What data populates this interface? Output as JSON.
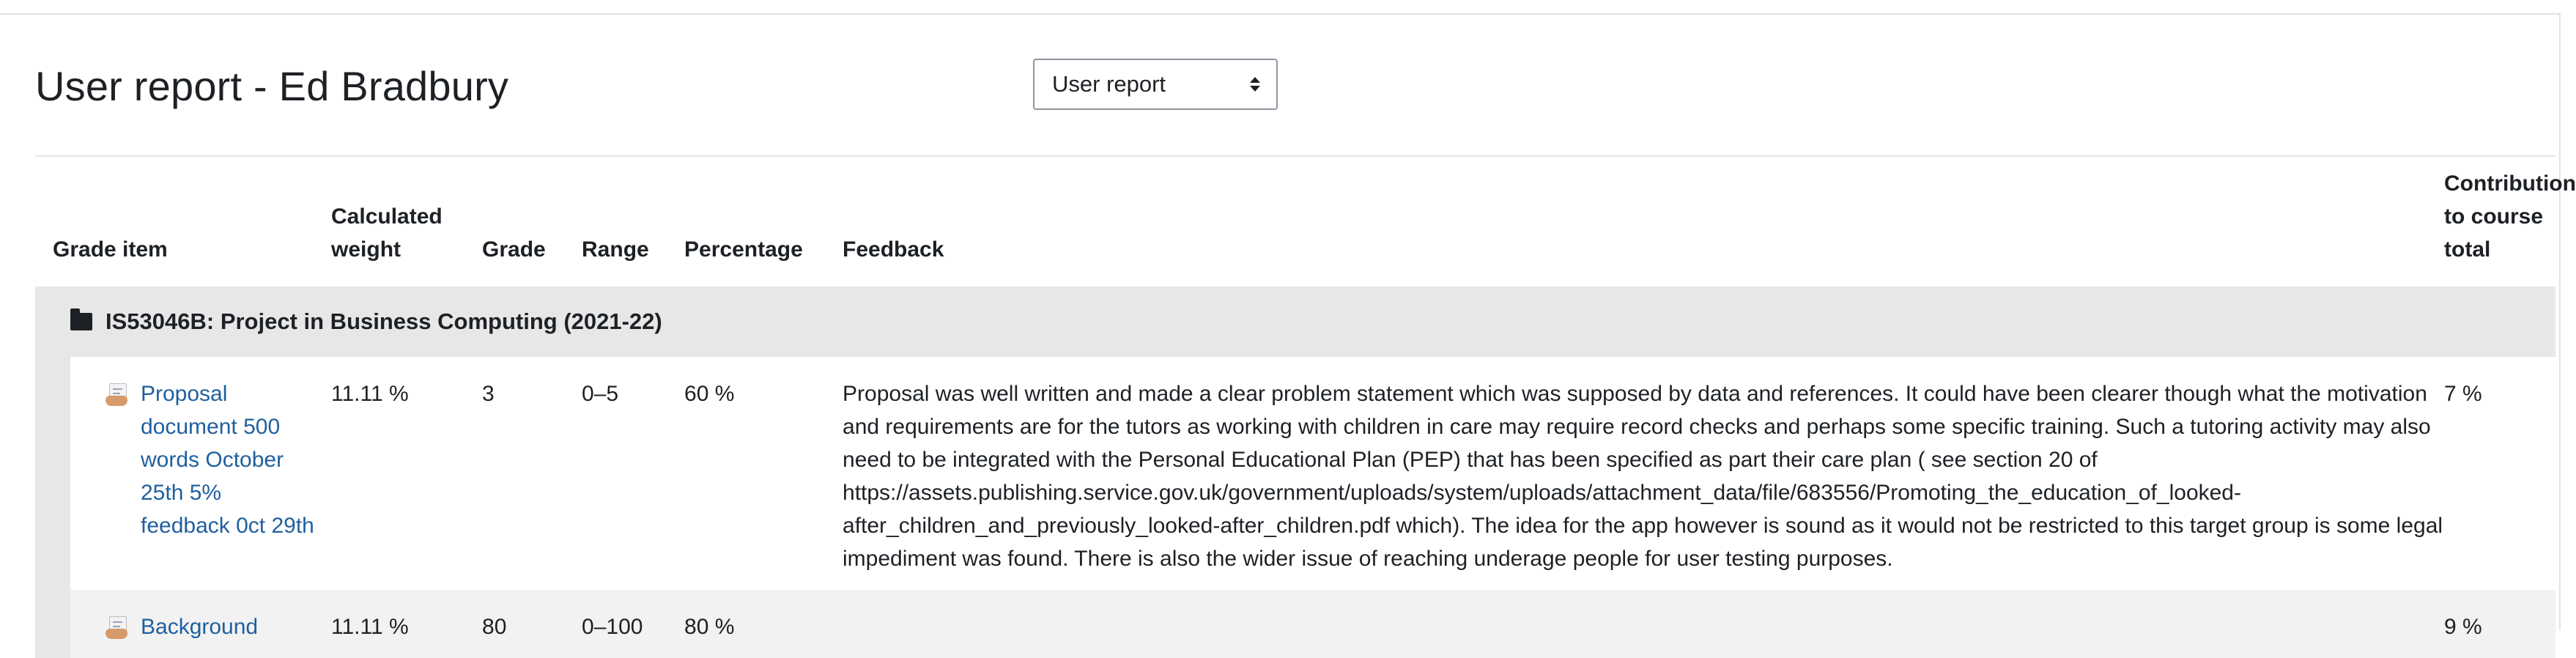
{
  "page": {
    "title": "User report - Ed Bradbury",
    "report_selector": {
      "selected": "User report",
      "icon": "select-caret-icon"
    }
  },
  "table": {
    "headers": {
      "grade_item": "Grade item",
      "weight": "Calculated weight",
      "grade": "Grade",
      "range": "Range",
      "percentage": "Percentage",
      "feedback": "Feedback",
      "contribution": "Contribution to course total"
    },
    "category": {
      "icon": "folder-icon",
      "name": "IS53046B: Project in Business Computing (2021-22)"
    },
    "items": [
      {
        "icon": "assignment-icon",
        "name": "Proposal document 500 words October 25th 5% feedback 0ct 29th",
        "weight": "11.11 %",
        "grade": "3",
        "range": "0–5",
        "percentage": "60 %",
        "feedback": "Proposal was well written and made a clear problem statement which was supposed by data and references. It could have been clearer though what the motivation and requirements are for the tutors as working with children in care may require record checks and perhaps some specific training. Such a tutoring activity may also need to be integrated with the Personal Educational Plan (PEP) that has been specified as part their care plan ( see section 20 of https://assets.publishing.service.gov.uk/government/uploads/system/uploads/attachment_data/file/683556/Promoting_the_education_of_looked-after_children_and_previously_looked-after_children.pdf which). The idea for the app however is sound as it would not be restricted to this target group is some legal impediment was found. There is also the wider issue of reaching underage people for user testing purposes.",
        "contribution": "7 %"
      },
      {
        "icon": "assignment-icon",
        "name": "Background",
        "weight": "11.11 %",
        "grade": "80",
        "range": "0–100",
        "percentage": "80 %",
        "feedback": "",
        "contribution": "9 %"
      }
    ]
  }
}
